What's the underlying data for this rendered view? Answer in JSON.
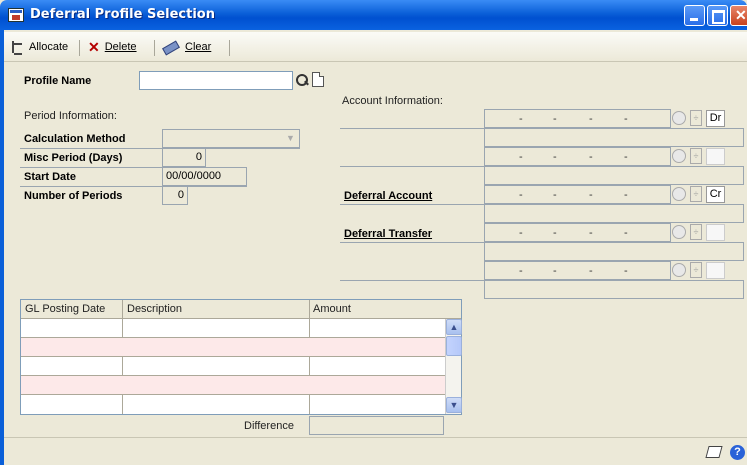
{
  "window": {
    "title": "Deferral Profile Selection"
  },
  "toolbar": {
    "allocate_label": "Allocate",
    "delete_label": "Delete",
    "clear_label": "Clear"
  },
  "form": {
    "profile_name_label": "Profile Name",
    "profile_name_value": "",
    "period_info_label": "Period Information:",
    "calc_method_label": "Calculation Method",
    "calc_method_value": "",
    "misc_period_label": "Misc Period (Days)",
    "misc_period_value": "0",
    "start_date_label": "Start Date",
    "start_date_value": "00/00/0000",
    "num_periods_label": "Number of Periods",
    "num_periods_value": "0"
  },
  "accounts": {
    "section_label": "Account Information:",
    "deferral_account_label": "Deferral Account",
    "deferral_transfer_label": "Deferral Transfer",
    "dash": "-",
    "dr_label": "Dr",
    "cr_label": "Cr",
    "spin_glyph": "÷"
  },
  "grid": {
    "columns": [
      "GL Posting Date",
      "Description",
      "Amount"
    ],
    "scroll_up": "▲",
    "scroll_down": "▼"
  },
  "footer": {
    "difference_label": "Difference",
    "difference_value": "",
    "help_glyph": "?"
  },
  "icons": [
    "allocate-icon",
    "delete-icon",
    "clear-icon",
    "search-icon",
    "new-document-icon",
    "note-icon",
    "help-icon"
  ]
}
